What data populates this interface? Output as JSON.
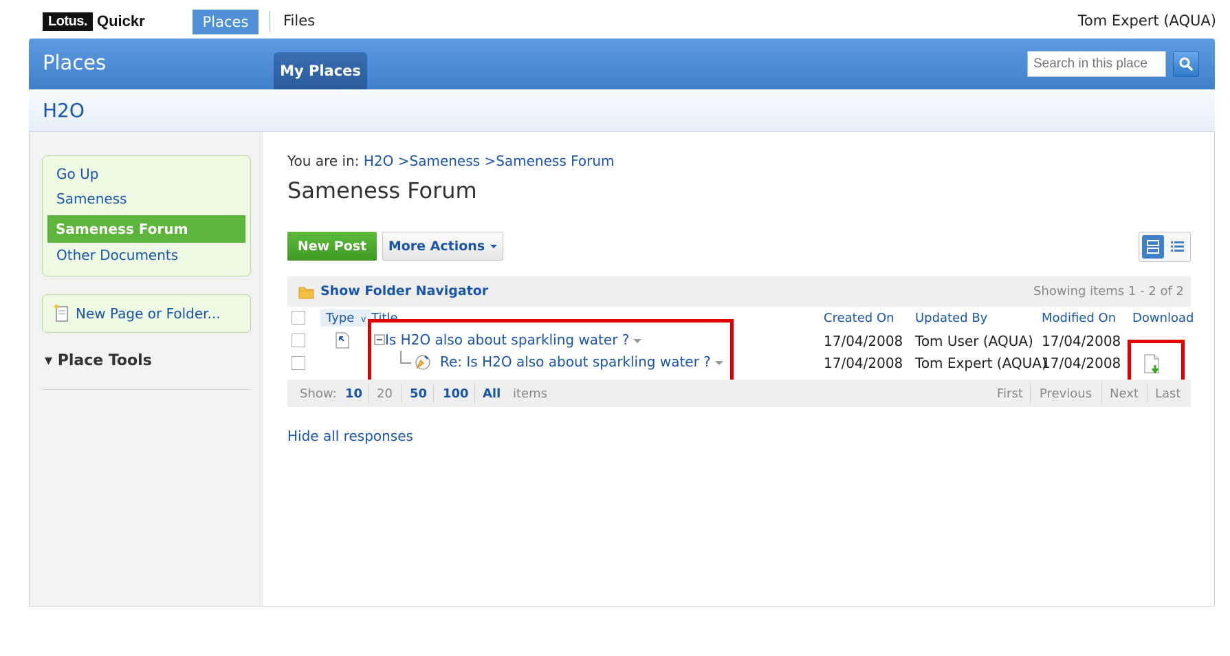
{
  "topbar": {
    "logo_lotus": "Lotus.",
    "logo_quickr": "Quickr",
    "nav_places": "Places",
    "nav_files": "Files",
    "user": "Tom Expert (AQUA)"
  },
  "header": {
    "title": "Places",
    "tab": "My Places",
    "search_placeholder": "Search in this place"
  },
  "place": {
    "title": "H2O"
  },
  "sidebar": {
    "items": [
      "Go Up",
      "Sameness",
      "Sameness Forum",
      "Other Documents"
    ],
    "new_page": "New Page or Folder...",
    "place_tools": "▾ Place Tools"
  },
  "main": {
    "breadcrumb_prefix": "You are in:",
    "breadcrumb": [
      "H2O",
      ">Sameness",
      ">Sameness Forum"
    ],
    "title": "Sameness Forum",
    "new_post": "New Post",
    "more_actions": "More Actions",
    "folder_nav": "Show Folder Navigator",
    "showing": "Showing items  1  -  2  of  2",
    "columns": {
      "type": "Type",
      "title": "Title",
      "created": "Created On",
      "updated": "Updated By",
      "modified": "Modified On",
      "download": "Download"
    },
    "rows": [
      {
        "title": "Is H2O also about sparkling water ?",
        "created": "17/04/2008",
        "updated_by": "Tom User (AQUA)",
        "modified": "17/04/2008"
      },
      {
        "title": "Re: Is H2O also about sparkling water ?",
        "created": "17/04/2008",
        "updated_by": "Tom Expert (AQUA)",
        "modified": "17/04/2008"
      }
    ],
    "pager": {
      "show": "Show:",
      "sizes": [
        "10",
        "20",
        "50",
        "100",
        "All"
      ],
      "items": "items",
      "first": "First",
      "previous": "Previous",
      "next": "Next",
      "last": "Last"
    },
    "hide_responses": "Hide all responses"
  },
  "colors": {
    "accent": "#3f80cb",
    "green": "#5cb43a",
    "link": "#1a56a8",
    "highlight": "#e00000"
  }
}
